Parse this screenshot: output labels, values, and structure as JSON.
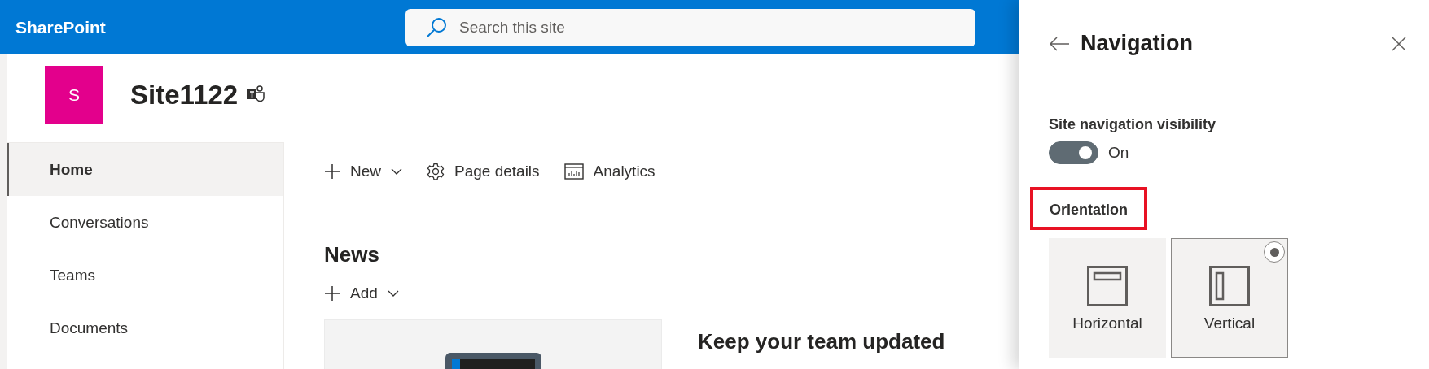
{
  "header": {
    "app_name": "SharePoint",
    "search": {
      "placeholder": "Search this site"
    }
  },
  "site": {
    "logo_letter": "S",
    "title": "Site1122"
  },
  "sidebar": {
    "items": [
      {
        "label": "Home",
        "selected": true
      },
      {
        "label": "Conversations",
        "selected": false
      },
      {
        "label": "Teams",
        "selected": false
      },
      {
        "label": "Documents",
        "selected": false
      }
    ]
  },
  "command_bar": [
    {
      "kind": "new",
      "label": "New"
    },
    {
      "kind": "details",
      "label": "Page details"
    },
    {
      "kind": "analytics",
      "label": "Analytics"
    }
  ],
  "news": {
    "title": "News",
    "add_label": "Add",
    "card_title": "Keep your team updated"
  },
  "panel": {
    "title": "Navigation",
    "visibility": {
      "label": "Site navigation visibility",
      "on": true,
      "state_text": "On"
    },
    "orientation": {
      "label": "Orientation",
      "highlighted": true,
      "options": [
        {
          "kind": "horizontal",
          "label": "Horizontal",
          "selected": false
        },
        {
          "kind": "vertical",
          "label": "Vertical",
          "selected": true
        }
      ]
    }
  }
}
